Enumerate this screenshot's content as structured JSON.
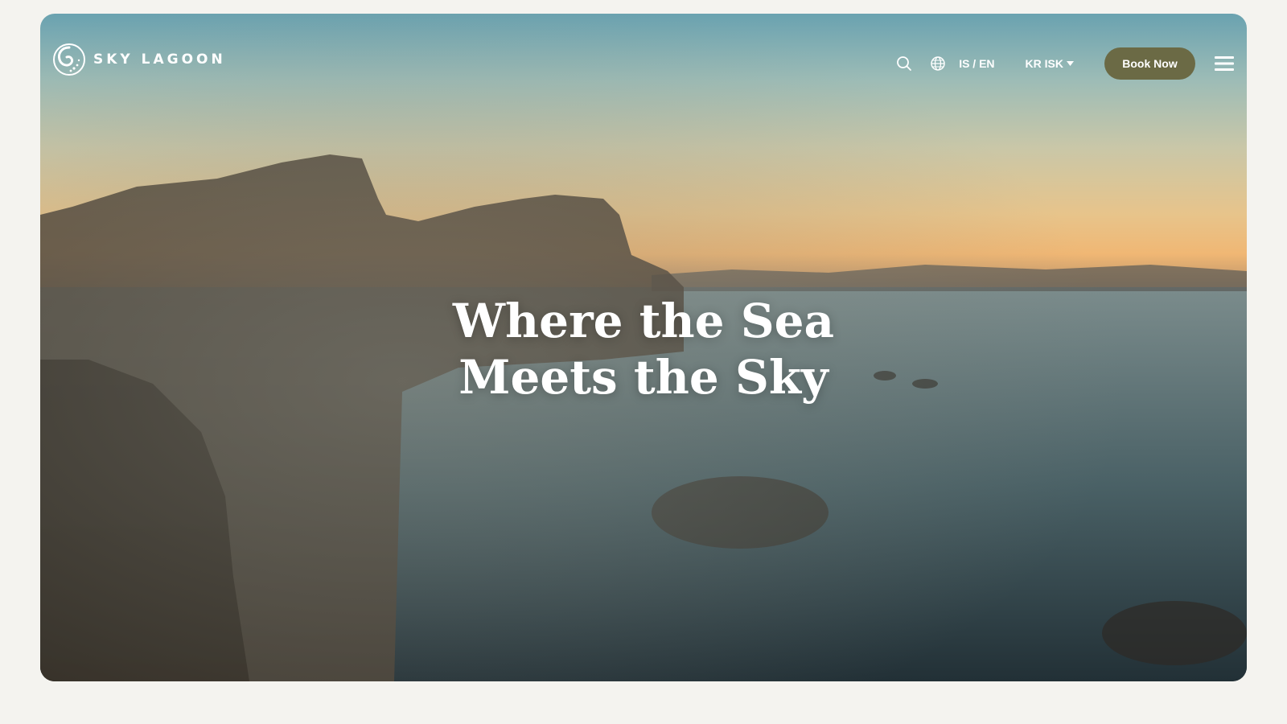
{
  "brand": {
    "name": "SKY LAGOON",
    "logo_icon": "sky-lagoon-swirl-icon"
  },
  "header": {
    "search_icon": "search-icon",
    "globe_icon": "globe-icon",
    "language_label": "IS / EN",
    "currency_label": "KR ISK",
    "currency_icon": "chevron-down-icon",
    "book_label": "Book Now",
    "menu_icon": "hamburger-menu-icon"
  },
  "hero": {
    "headline_line1": "Where the Sea",
    "headline_line2": "Meets the Sky"
  },
  "colors": {
    "page_background": "#f4f3ef",
    "book_button": "#6b6a45",
    "text": "#ffffff"
  }
}
